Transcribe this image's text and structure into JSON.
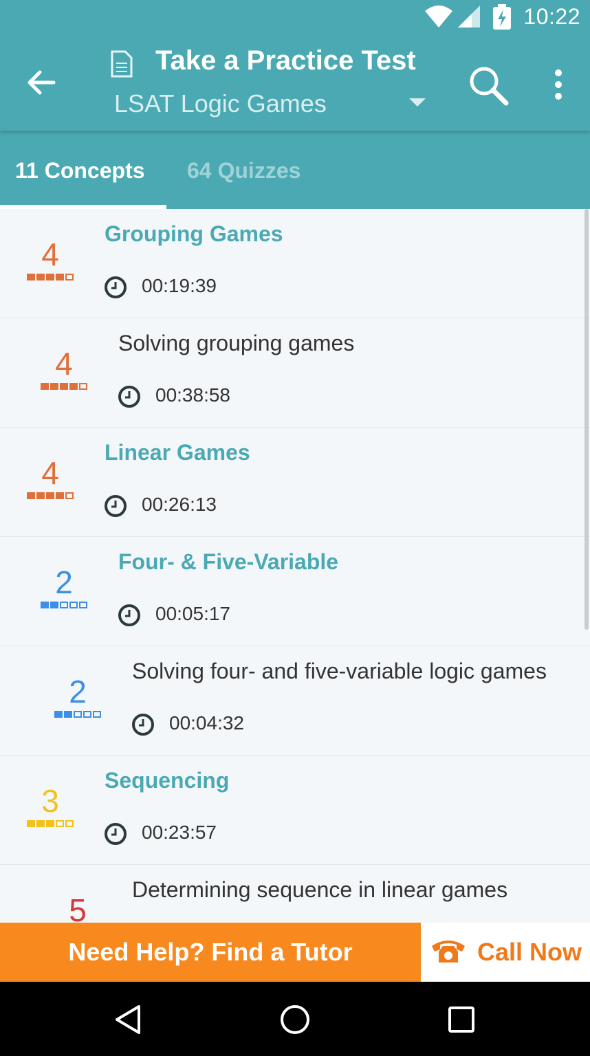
{
  "status_bar": {
    "time": "10:22",
    "icons": [
      "wifi-icon",
      "signal-icon",
      "battery-charging-icon"
    ]
  },
  "app_bar": {
    "title": "Take a Practice Test",
    "subtitle": "LSAT Logic Games",
    "icons": [
      "back-arrow-icon",
      "document-icon",
      "dropdown-icon",
      "search-icon",
      "more-vert-icon"
    ]
  },
  "tabs": [
    {
      "label": "11 Concepts",
      "active": true
    },
    {
      "label": "64 Quizzes",
      "active": false
    }
  ],
  "list": [
    {
      "type": "concept",
      "title": "Grouping Games",
      "level": "4",
      "duration": "00:19:39"
    },
    {
      "type": "lesson",
      "title": "Solving grouping games",
      "level": "4",
      "duration": "00:38:58"
    },
    {
      "type": "concept",
      "title": "Linear Games",
      "level": "4",
      "duration": "00:26:13"
    },
    {
      "type": "concept",
      "title": "Four- & Five-Variable",
      "level": "2",
      "duration": "00:05:17"
    },
    {
      "type": "lesson",
      "title": "Solving four- and five-variable logic games",
      "level": "2",
      "duration": "00:04:32"
    },
    {
      "type": "concept",
      "title": "Sequencing",
      "level": "3",
      "duration": "00:23:57"
    },
    {
      "type": "lesson",
      "title": "Determining sequence in linear games",
      "level": "5",
      "duration": ""
    }
  ],
  "level_colors": {
    "2": "#3d8ee6",
    "3": "#f2c21b",
    "4": "#e0703a",
    "5": "#d9363e"
  },
  "banner": {
    "tutor_label": "Need Help? Find a Tutor",
    "call_label": "Call Now",
    "tutor_color": "#f7891e"
  },
  "nav_bar": {
    "icons": [
      "nav-back-icon",
      "nav-home-icon",
      "nav-recents-icon"
    ]
  }
}
